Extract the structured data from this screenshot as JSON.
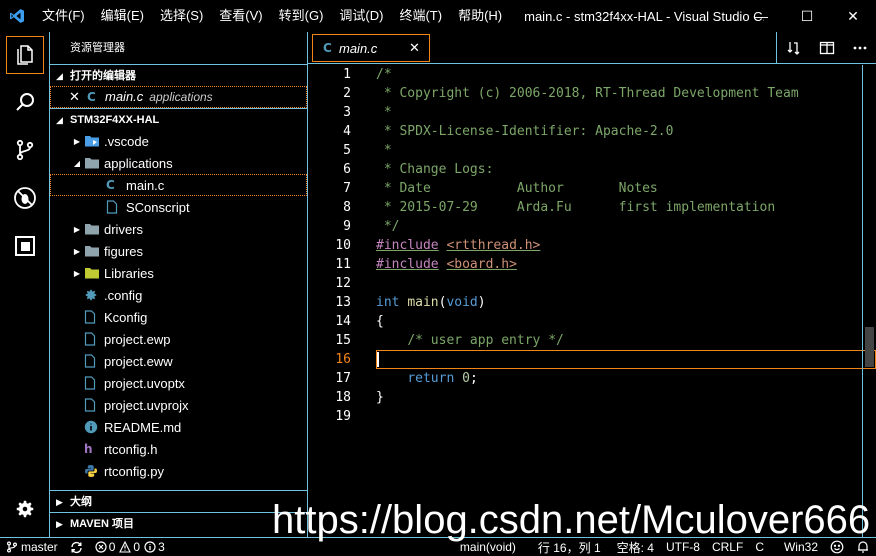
{
  "titlebar": {
    "menu": [
      "文件(F)",
      "编辑(E)",
      "选择(S)",
      "查看(V)",
      "转到(G)",
      "调试(D)",
      "终端(T)",
      "帮助(H)"
    ],
    "title": "main.c - stm32f4xx-HAL - Visual Studio C...",
    "minimize": "—",
    "maximize": "☐",
    "close": "✕"
  },
  "activitybar": {
    "icons": [
      "explorer-icon",
      "search-icon",
      "source-control-icon",
      "debug-icon",
      "extensions-icon"
    ],
    "settings_icon": "gear-icon"
  },
  "sidebar": {
    "title": "资源管理器",
    "open_editors_label": "打开的编辑器",
    "open_editor": {
      "close": "✕",
      "name": "main.c",
      "description": "applications"
    },
    "project_label": "STM32F4XX-HAL",
    "tree": [
      {
        "name": ".vscode",
        "type": "folder-vscode",
        "depth": 0,
        "expanded": false
      },
      {
        "name": "applications",
        "type": "folder",
        "depth": 0,
        "expanded": true
      },
      {
        "name": "main.c",
        "type": "c",
        "depth": 1,
        "selected": true
      },
      {
        "name": "SConscript",
        "type": "file",
        "depth": 1
      },
      {
        "name": "drivers",
        "type": "folder",
        "depth": 0,
        "expanded": false
      },
      {
        "name": "figures",
        "type": "folder",
        "depth": 0,
        "expanded": false
      },
      {
        "name": "Libraries",
        "type": "folder-lib",
        "depth": 0,
        "expanded": false
      },
      {
        "name": ".config",
        "type": "gear",
        "depth": 0
      },
      {
        "name": "Kconfig",
        "type": "file",
        "depth": 0
      },
      {
        "name": "project.ewp",
        "type": "file",
        "depth": 0
      },
      {
        "name": "project.eww",
        "type": "file",
        "depth": 0
      },
      {
        "name": "project.uvoptx",
        "type": "file",
        "depth": 0
      },
      {
        "name": "project.uvprojx",
        "type": "file",
        "depth": 0
      },
      {
        "name": "README.md",
        "type": "info",
        "depth": 0
      },
      {
        "name": "rtconfig.h",
        "type": "h",
        "depth": 0
      },
      {
        "name": "rtconfig.py",
        "type": "py",
        "depth": 0
      }
    ],
    "outline_label": "大纲",
    "maven_label": "MAVEN 项目"
  },
  "editor": {
    "tab": {
      "name": "main.c",
      "close": "✕"
    },
    "actions": [
      "compare-icon",
      "split-editor-icon",
      "more-icon"
    ],
    "current_line": 16,
    "lines": [
      [
        [
          "cm",
          "/*"
        ]
      ],
      [
        [
          "cm",
          " * Copyright (c) 2006-2018, RT-Thread Development Team"
        ]
      ],
      [
        [
          "cm",
          " *"
        ]
      ],
      [
        [
          "cm",
          " * SPDX-License-Identifier: Apache-2.0"
        ]
      ],
      [
        [
          "cm",
          " *"
        ]
      ],
      [
        [
          "cm",
          " * Change Logs:"
        ]
      ],
      [
        [
          "cm",
          " * Date           Author       Notes"
        ]
      ],
      [
        [
          "cm",
          " * 2015-07-29     Arda.Fu      first implementation"
        ]
      ],
      [
        [
          "cm",
          " */"
        ]
      ],
      [
        [
          "pp ul",
          "#include"
        ],
        [
          "pl",
          " "
        ],
        [
          "str ul",
          "<rtthread.h>"
        ]
      ],
      [
        [
          "pp ul",
          "#include"
        ],
        [
          "pl",
          " "
        ],
        [
          "str ul",
          "<board.h>"
        ]
      ],
      [],
      [
        [
          "kw",
          "int"
        ],
        [
          "pl",
          " "
        ],
        [
          "fn",
          "main"
        ],
        [
          "pl",
          "("
        ],
        [
          "kw",
          "void"
        ],
        [
          "pl",
          ")"
        ]
      ],
      [
        [
          "pl",
          "{"
        ]
      ],
      [
        [
          "pl",
          "    "
        ],
        [
          "cm",
          "/* user app entry */"
        ]
      ],
      [],
      [
        [
          "pl",
          "    "
        ],
        [
          "kw",
          "return"
        ],
        [
          "pl",
          " "
        ],
        [
          "num",
          "0"
        ],
        [
          "pl",
          ";"
        ]
      ],
      [
        [
          "pl",
          "}"
        ]
      ],
      []
    ]
  },
  "statusbar": {
    "branch": "master",
    "sync_icon": "sync-icon",
    "errors": "0",
    "warnings": "0",
    "infos": "3",
    "function": "main(void)",
    "position": "行 16，列 1",
    "spaces": "空格: 4",
    "encoding": "UTF-8",
    "eol": "CRLF",
    "language": "C",
    "platform": "Win32"
  },
  "watermark": "https://blog.csdn.net/Mculover666"
}
